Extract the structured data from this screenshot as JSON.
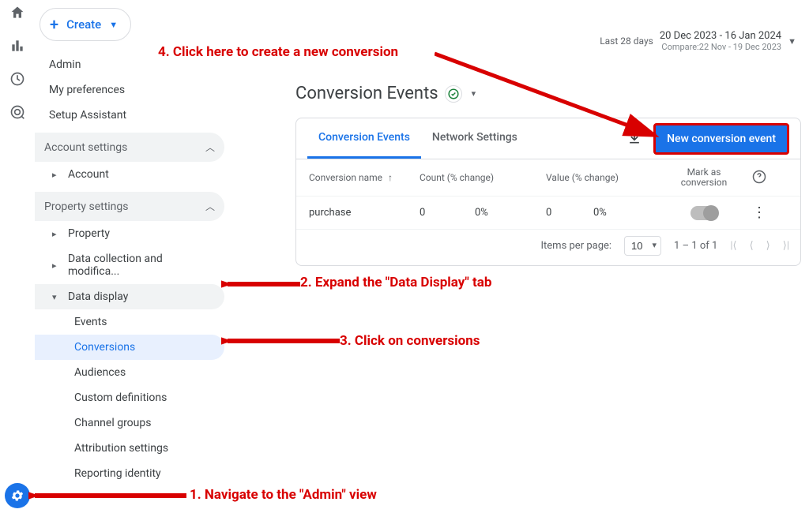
{
  "leftrail": {
    "items": [
      "home",
      "reports",
      "explore",
      "advertising"
    ]
  },
  "create_button": {
    "label": "Create"
  },
  "sidebar": {
    "links": [
      {
        "label": "Admin"
      },
      {
        "label": "My preferences"
      },
      {
        "label": "Setup Assistant"
      }
    ],
    "account_group": {
      "label": "Account settings"
    },
    "account_item": {
      "label": "Account"
    },
    "property_group": {
      "label": "Property settings"
    },
    "property_items": [
      {
        "label": "Property"
      },
      {
        "label": "Data collection and modifica..."
      }
    ],
    "data_display": {
      "label": "Data display"
    },
    "data_display_children": [
      {
        "label": "Events"
      },
      {
        "label": "Conversions"
      },
      {
        "label": "Audiences"
      },
      {
        "label": "Custom definitions"
      },
      {
        "label": "Channel groups"
      },
      {
        "label": "Attribution settings"
      },
      {
        "label": "Reporting identity"
      }
    ]
  },
  "date_range": {
    "preset": "Last 28 days",
    "range": "20 Dec 2023 - 16 Jan 2024",
    "compare": "Compare:22 Nov - 19 Dec 2023"
  },
  "page": {
    "title": "Conversion Events"
  },
  "tabs": [
    {
      "label": "Conversion Events"
    },
    {
      "label": "Network Settings"
    }
  ],
  "new_button": {
    "label": "New conversion event"
  },
  "table": {
    "headers": {
      "name": "Conversion name",
      "count": "Count (% change)",
      "value": "Value (% change)",
      "mark": "Mark as conversion"
    },
    "rows": [
      {
        "name": "purchase",
        "count": "0",
        "count_pct": "0%",
        "value": "0",
        "value_pct": "0%"
      }
    ]
  },
  "pager": {
    "items_label": "Items per page:",
    "per_page": "10",
    "range": "1 – 1 of 1"
  },
  "annotations": {
    "a1": "1. Navigate to the \"Admin\" view",
    "a2": "2. Expand the \"Data Display\" tab",
    "a3": "3. Click on conversions",
    "a4": "4. Click here to create a new conversion"
  }
}
